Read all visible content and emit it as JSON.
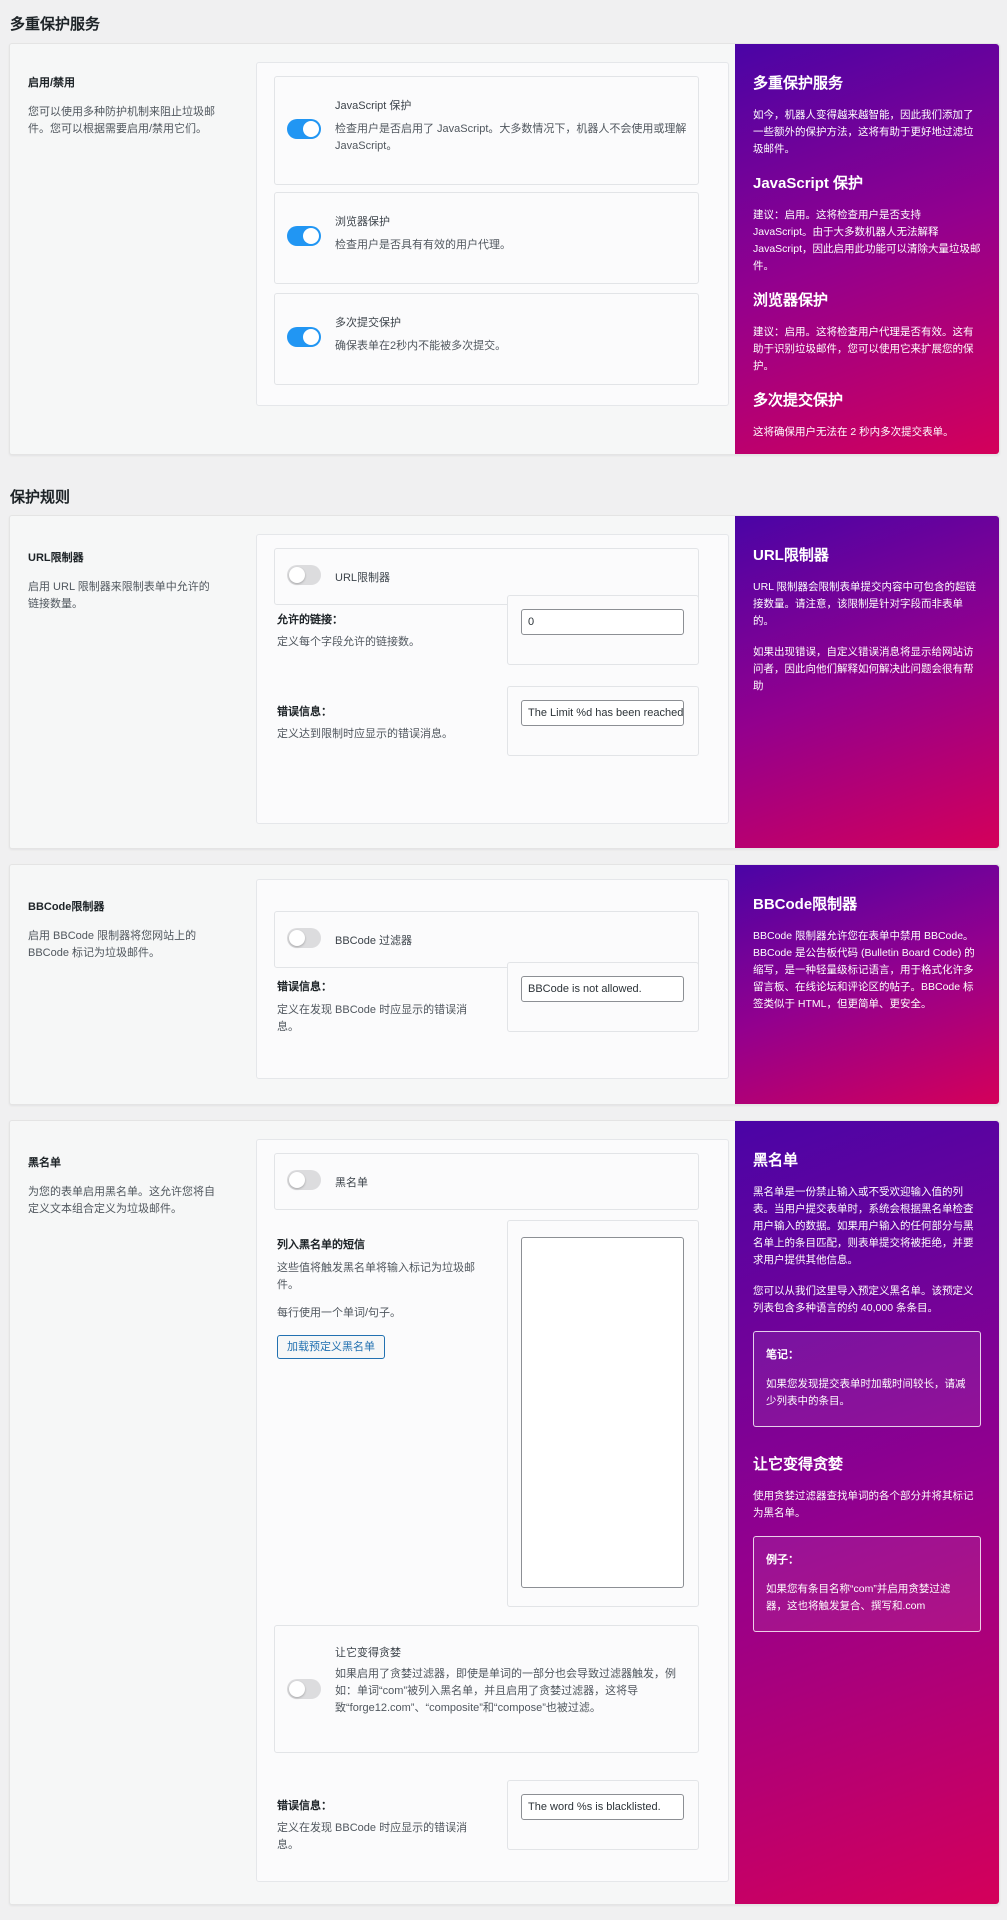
{
  "section1": {
    "title": "多重保护服务",
    "left_title": "启用/禁用",
    "left_desc": "您可以使用多种防护机制来阻止垃圾邮件。您可以根据需要启用/禁用它们。",
    "options": [
      {
        "title": "JavaScript 保护",
        "desc": "检查用户是否启用了 JavaScript。大多数情况下，机器人不会使用或理解 JavaScript。",
        "enabled": true
      },
      {
        "title": "浏览器保护",
        "desc": "检查用户是否具有有效的用户代理。",
        "enabled": true
      },
      {
        "title": "多次提交保护",
        "desc": "确保表单在2秒内不能被多次提交。",
        "enabled": true
      }
    ],
    "info": {
      "h1": "多重保护服务",
      "p1": "如今，机器人变得越来越智能，因此我们添加了一些额外的保护方法，这将有助于更好地过滤垃圾邮件。",
      "h2": "JavaScript 保护",
      "p2": "建议：启用。这将检查用户是否支持 JavaScript。由于大多数机器人无法解释 JavaScript，因此启用此功能可以清除大量垃圾邮件。",
      "h3": "浏览器保护",
      "p3": "建议：启用。这将检查用户代理是否有效。这有助于识别垃圾邮件，您可以使用它来扩展您的保护。",
      "h4": "多次提交保护",
      "p4": "这将确保用户无法在 2 秒内多次提交表单。"
    }
  },
  "section2": {
    "title": "保护规则",
    "url": {
      "left_title": "URL限制器",
      "left_desc": "启用 URL 限制器来限制表单中允许的链接数量。",
      "toggle_label": "URL限制器",
      "enabled": false,
      "links_title": "允许的链接：",
      "links_desc": "定义每个字段允许的链接数。",
      "links_value": "0",
      "error_title": "错误信息：",
      "error_desc": "定义达到限制时应显示的错误消息。",
      "error_value": "The Limit %d has been reached",
      "info_h": "URL限制器",
      "info_p1": "URL 限制器会限制表单提交内容中可包含的超链接数量。请注意，该限制是针对字段而非表单的。",
      "info_p2": "如果出现错误，自定义错误消息将显示给网站访问者，因此向他们解释如何解决此问题会很有帮助"
    },
    "bbcode": {
      "left_title": "BBCode限制器",
      "left_desc": "启用 BBCode 限制器将您网站上的 BBCode 标记为垃圾邮件。",
      "toggle_label": "BBCode 过滤器",
      "enabled": false,
      "error_title": "错误信息：",
      "error_desc": "定义在发现 BBCode 时应显示的错误消息。",
      "error_value": "BBCode is not allowed.",
      "info_h": "BBCode限制器",
      "info_p1": "BBCode 限制器允许您在表单中禁用 BBCode。BBCode 是公告板代码 (Bulletin Board Code) 的缩写，是一种轻量级标记语言，用于格式化许多留言板、在线论坛和评论区的帖子。BBCode 标签类似于 HTML，但更简单、更安全。"
    },
    "blacklist": {
      "left_title": "黑名单",
      "left_desc": "为您的表单启用黑名单。这允许您将自定义文本组合定义为垃圾邮件。",
      "toggle_label": "黑名单",
      "enabled": false,
      "list_title": "列入黑名单的短信",
      "list_desc1": "这些值将触发黑名单将输入标记为垃圾邮件。",
      "list_desc2": "每行使用一个单词/句子。",
      "load_button": "加载预定义黑名单",
      "greedy_title": "让它变得贪婪",
      "greedy_desc": "如果启用了贪婪过滤器，即使是单词的一部分也会导致过滤器触发，例如：单词“com”被列入黑名单，并且启用了贪婪过滤器，这将导致“forge12.com”、“composite”和“compose”也被过滤。",
      "greedy_enabled": false,
      "error_title": "错误信息：",
      "error_desc": "定义在发现 BBCode 时应显示的错误消息。",
      "error_value": "The word %s is blacklisted.",
      "info_h1": "黑名单",
      "info_p1": "黑名单是一份禁止输入或不受欢迎输入值的列表。当用户提交表单时，系统会根据黑名单检查用户输入的数据。如果用户输入的任何部分与黑名单上的条目匹配，则表单提交将被拒绝，并要求用户提供其他信息。",
      "info_p2": "您可以从我们这里导入预定义黑名单。该预定义列表包含多种语言的约 40,000 条条目。",
      "note_title": "笔记：",
      "note_text": "如果您发现提交表单时加载时间较长，请减少列表中的条目。",
      "info_h2": "让它变得贪婪",
      "info_p3": "使用贪婪过滤器查找单词的各个部分并将其标记为黑名单。",
      "example_title": "例子：",
      "example_text": "如果您有条目名称“com”并启用贪婪过滤器，这也将触发复合、撰写和.com"
    }
  }
}
